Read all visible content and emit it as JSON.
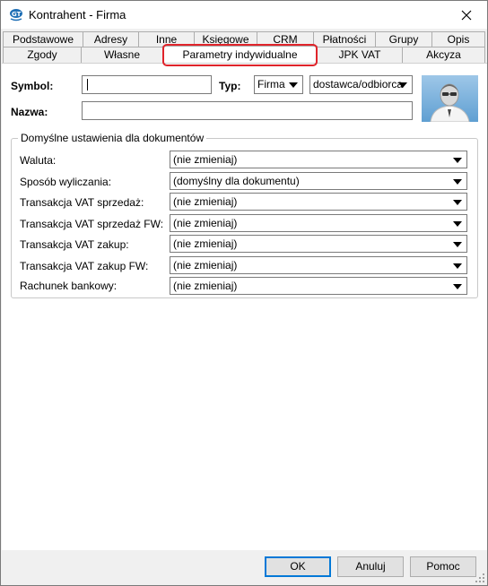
{
  "window": {
    "title": "Kontrahent - Firma"
  },
  "tabs": {
    "row1": [
      "Podstawowe",
      "Adresy",
      "Inne",
      "Księgowe",
      "CRM",
      "Płatności",
      "Grupy",
      "Opis"
    ],
    "row2": [
      "Zgody",
      "Własne",
      "Parametry indywidualne",
      "JPK VAT",
      "Akcyza"
    ],
    "active": "Parametry indywidualne"
  },
  "form": {
    "symbol_label": "Symbol:",
    "symbol_value": "",
    "typ_label": "Typ:",
    "typ_value": "Firma",
    "role_value": "dostawca/odbiorca",
    "nazwa_label": "Nazwa:",
    "nazwa_value": ""
  },
  "group": {
    "title": "Domyślne ustawienia dla dokumentów",
    "rows": [
      {
        "label": "Waluta:",
        "value": "(nie zmieniaj)"
      },
      {
        "label": "Sposób wyliczania:",
        "value": "(domyślny dla dokumentu)"
      },
      {
        "label": "Transakcja VAT sprzedaż:",
        "value": "(nie zmieniaj)"
      },
      {
        "label": "Transakcja VAT sprzedaż FW:",
        "value": "(nie zmieniaj)"
      },
      {
        "label": "Transakcja VAT zakup:",
        "value": "(nie zmieniaj)"
      },
      {
        "label": "Transakcja VAT zakup FW:",
        "value": "(nie zmieniaj)"
      },
      {
        "label": "Rachunek bankowy:",
        "value": "(nie zmieniaj)"
      }
    ]
  },
  "buttons": {
    "ok": "OK",
    "cancel": "Anuluj",
    "help": "Pomoc"
  },
  "colors": {
    "highlight": "#e0242b",
    "accent": "#0078d7"
  },
  "icons": [
    "app-logo-icon",
    "close-icon",
    "avatar-icon",
    "dropdown-arrow-icon",
    "resize-grip-icon"
  ]
}
